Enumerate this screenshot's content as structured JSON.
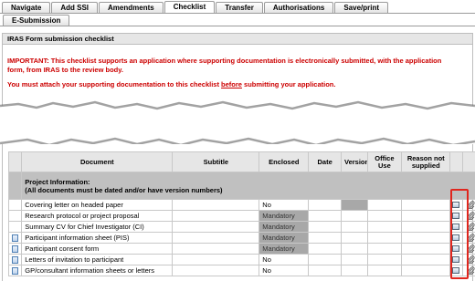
{
  "tabs": {
    "row1": [
      "Navigate",
      "Add SSI",
      "Amendments",
      "Checklist",
      "Transfer",
      "Authorisations",
      "Save/print"
    ],
    "row2": [
      "E-Submission"
    ],
    "active": "Checklist"
  },
  "panel": {
    "title": "IRAS Form submission checklist",
    "important": "IMPORTANT: This checklist supports an application where supporting documentation is electronically submitted, with the application form, from IRAS to the review body.",
    "attach_before": "You must attach your supporting documentation to this checklist ",
    "attach_underlined": "before",
    "attach_after": " submitting your application."
  },
  "table": {
    "headers": [
      "Document",
      "Subtitle",
      "Enclosed",
      "Date",
      "Version",
      "Office Use",
      "Reason not supplied"
    ],
    "section": "Project Information:\n(All documents must be dated and/or have version numbers)",
    "rows": [
      {
        "document": "Covering letter on headed paper",
        "enclosed": "No",
        "doc_icon": false,
        "mandatory": false
      },
      {
        "document": "Research protocol or project proposal",
        "enclosed": "Mandatory",
        "doc_icon": false,
        "mandatory": true
      },
      {
        "document": "Summary CV for Chief Investigator (CI)",
        "enclosed": "Mandatory",
        "doc_icon": false,
        "mandatory": true
      },
      {
        "document": "Participant information sheet (PIS)",
        "enclosed": "Mandatory",
        "doc_icon": true,
        "mandatory": true
      },
      {
        "document": "Participant consent form",
        "enclosed": "Mandatory",
        "doc_icon": true,
        "mandatory": true
      },
      {
        "document": "Letters of invitation to participant",
        "enclosed": "No",
        "doc_icon": true,
        "mandatory": false
      },
      {
        "document": "GP/consultant information sheets or letters",
        "enclosed": "No",
        "doc_icon": true,
        "mandatory": false
      }
    ]
  },
  "colors": {
    "notice": "#cc0000",
    "highlight": "#e0261e",
    "header_bg": "#e6e6e6",
    "section_bg": "#c0c0c0",
    "mandatory_bg": "#a8a8a8"
  },
  "icons": {
    "document": "document-icon",
    "view": "view-icon",
    "attach": "paperclip-icon"
  }
}
